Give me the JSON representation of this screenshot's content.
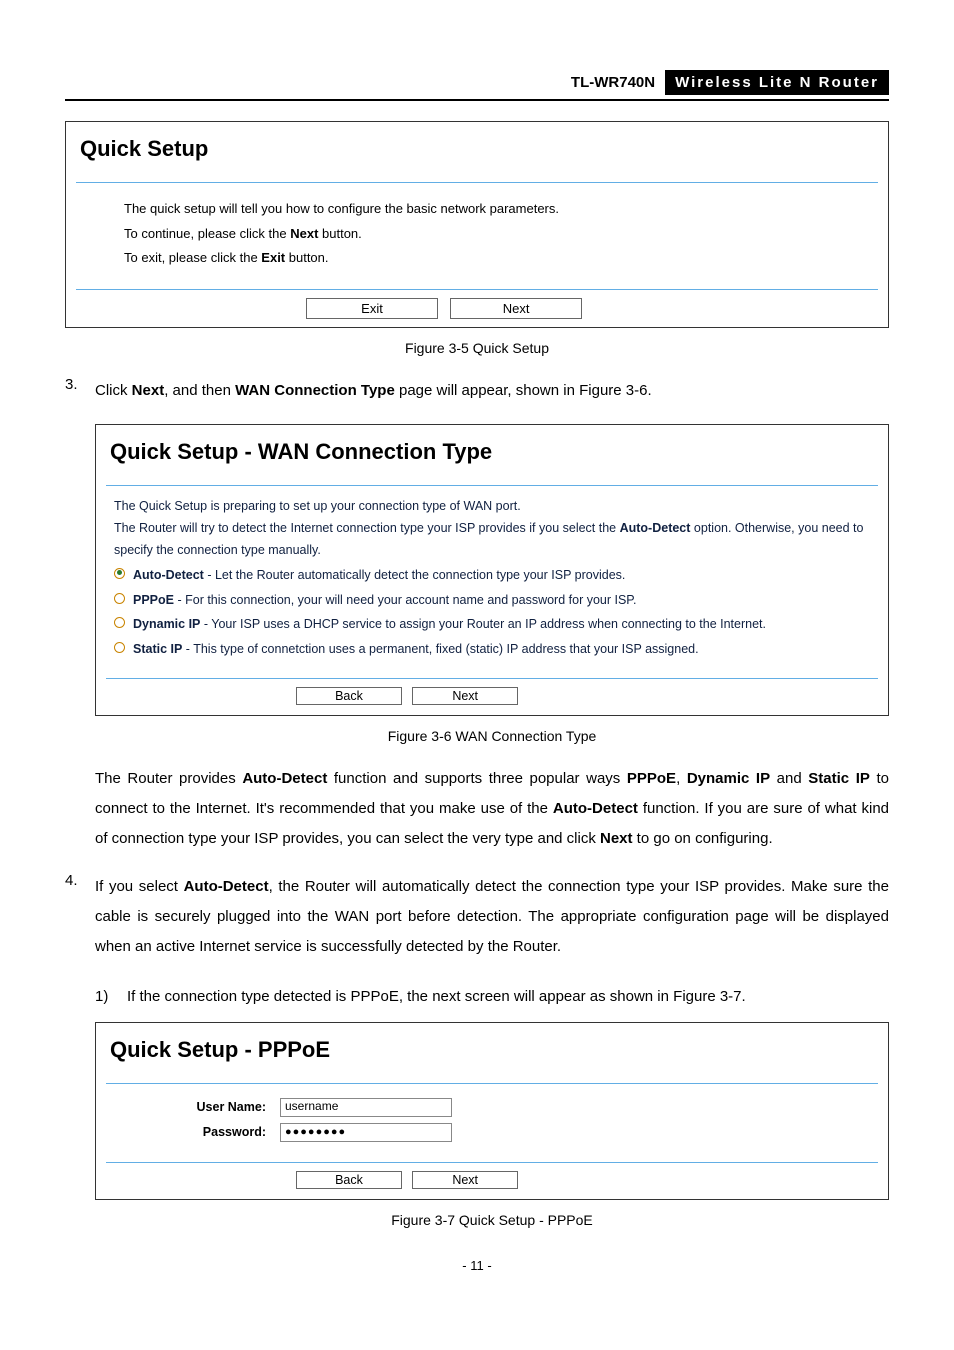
{
  "header": {
    "model": "TL-WR740N",
    "desc": "Wireless Lite N Router"
  },
  "panel1": {
    "title": "Quick Setup",
    "line1": "The quick setup will tell you how to configure the basic network parameters.",
    "line2_pre": "To continue, please click the ",
    "line2_bold": "Next",
    "line2_post": " button.",
    "line3_pre": "To exit, please click the ",
    "line3_bold": "Exit",
    "line3_post": "  button.",
    "btn_exit": "Exit",
    "btn_next": "Next"
  },
  "caption1": "Figure 3-5    Quick Setup",
  "step3": {
    "num": "3.",
    "pre": "Click ",
    "b1": "Next",
    "mid": ", and then ",
    "b2": "WAN Connection Type",
    "post": " page will appear, shown in Figure 3-6."
  },
  "panel2": {
    "title": "Quick Setup - WAN Connection Type",
    "intro": "The Quick Setup is preparing to set up your connection type of WAN port.",
    "detect_pre": "The Router will try to detect the Internet connection type your ISP provides if you select the ",
    "detect_b": "Auto-Detect",
    "detect_post": " option. Otherwise, you need to specify the connection type manually.",
    "opts": [
      {
        "b": "Auto-Detect",
        "rest": " - Let the Router automatically detect the connection type your ISP provides.",
        "sel": true
      },
      {
        "b": "PPPoE",
        "rest": " - For this connection, your will need your account name and password for your ISP.",
        "sel": false
      },
      {
        "b": "Dynamic IP",
        "rest": " - Your ISP uses a DHCP service to assign your Router an IP address when connecting to the Internet.",
        "sel": false
      },
      {
        "b": "Static IP",
        "rest": " - This type of connetction uses a permanent, fixed (static) IP address that your ISP assigned.",
        "sel": false
      }
    ],
    "btn_back": "Back",
    "btn_next": "Next"
  },
  "caption2": "Figure 3-6    WAN Connection Type",
  "para_router": {
    "p1": "The Router provides ",
    "b1": "Auto-Detect",
    "p2": " function and supports three popular ways ",
    "b2": "PPPoE",
    "p3": ", ",
    "b3": "Dynamic IP",
    "p4": " and ",
    "b4": "Static IP",
    "p5": " to connect to the Internet. It's recommended that you make use of the ",
    "b5": "Auto-Detect",
    "p6": " function. If you are sure of what kind of connection type your ISP provides, you can select the very type and click ",
    "b6": "Next",
    "p7": " to go on configuring."
  },
  "step4": {
    "num": "4.",
    "p1": "If you select ",
    "b1": "Auto-Detect",
    "p2": ", the Router will automatically detect the connection type your ISP provides. Make sure the cable is securely plugged into the WAN port before detection. The appropriate configuration page will be displayed when an active Internet service is successfully detected by the Router."
  },
  "sub1": {
    "num": "1)",
    "text": "If the connection type detected is PPPoE, the next screen will appear as shown in Figure 3-7."
  },
  "panel3": {
    "title": "Quick Setup - PPPoE",
    "user_label": "User Name:",
    "user_value": "username",
    "pass_label": "Password:",
    "pass_value": "●●●●●●●●",
    "btn_back": "Back",
    "btn_next": "Next"
  },
  "caption3": "Figure 3-7    Quick Setup - PPPoE",
  "page_num": "- 11 -"
}
